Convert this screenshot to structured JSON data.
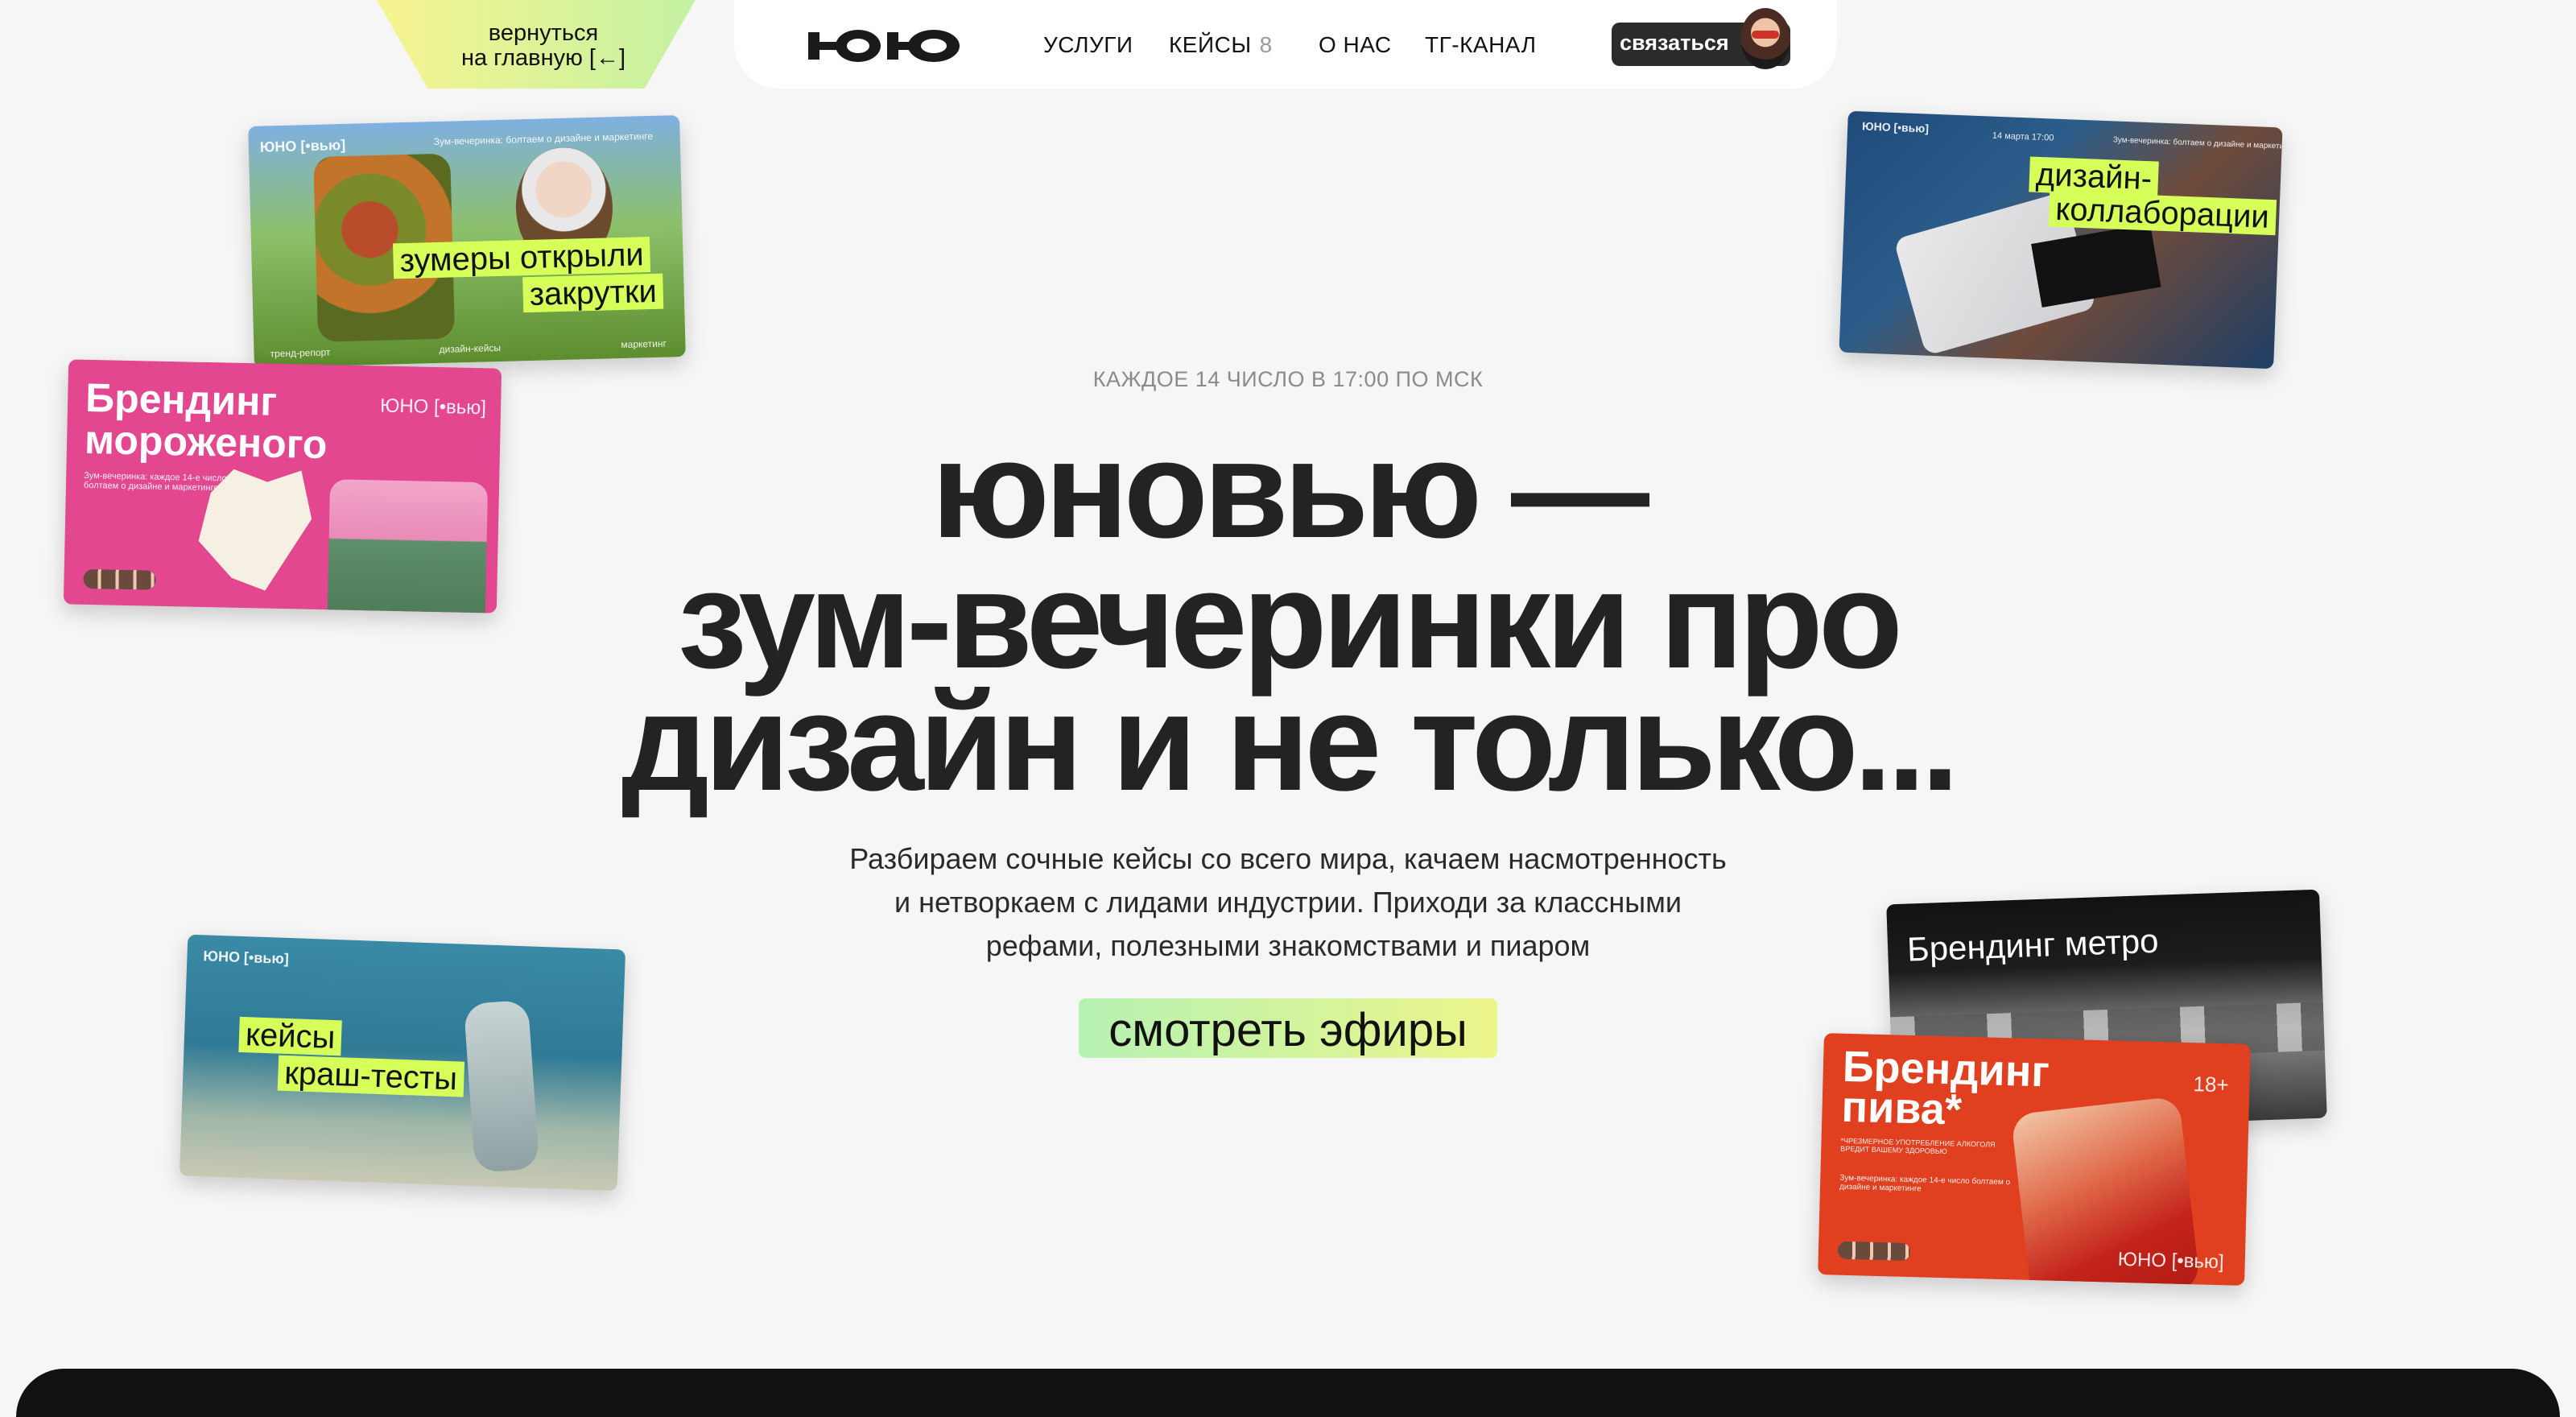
{
  "back_link": {
    "line1": "вернуться",
    "line2": "на главную [←]"
  },
  "nav": {
    "logo_alt": "ЮНО",
    "items": [
      {
        "label": "УСЛУГИ"
      },
      {
        "label": "КЕЙСЫ",
        "count": "8"
      },
      {
        "label": "О НАС"
      },
      {
        "label": "ТГ-КАНАЛ"
      }
    ],
    "contact_label": "связаться"
  },
  "cards": {
    "zoomers": {
      "logo": "ЮНО [•вью]",
      "header": "Зум-вечеринка: болтаем о дизайне и маркетинге",
      "tag_line1": "зумеры открыли",
      "tag_line2": "закрутки",
      "foot1": "тренд-репорт",
      "foot2": "дизайн-кейсы",
      "foot3": "маркетинг"
    },
    "ice_cream": {
      "title_line1": "Брендинг",
      "title_line2": "мороженого",
      "logo": "ЮНО [•вью]",
      "sub": "Зум-вечеринка: каждое 14-е число болтаем о дизайне и маркетинге"
    },
    "collab": {
      "logo": "ЮНО [•вью]",
      "date": "14 марта 17:00",
      "header": "Зум-вечеринка: болтаем о дизайне и маркетинге",
      "tag_line1": "дизайн-",
      "tag_line2": "коллаборации"
    },
    "crash": {
      "logo": "ЮНО [•вью]",
      "tag_line1": "кейсы",
      "tag_line2": "краш-тесты"
    },
    "metro": {
      "title": "Брендинг метро"
    },
    "beer": {
      "title_line1": "Брендинг",
      "title_line2": "пива*",
      "age": "18+",
      "warning": "*ЧРЕЗМЕРНОЕ УПОТРЕБЛЕНИЕ АЛКОГОЛЯ ВРЕДИТ ВАШЕМУ ЗДОРОВЬЮ",
      "sub": "Зум-вечеринка: каждое 14-е число болтаем о дизайне и маркетинге",
      "logo": "ЮНО [•вью]"
    }
  },
  "hero": {
    "eyebrow": "КАЖДОЕ 14 ЧИСЛО В 17:00 ПО МСК",
    "title_line1": "юновью —",
    "title_line2": "зум-вечеринки про",
    "title_line3": "дизайн и не только...",
    "desc_line1": "Разбираем сочные кейсы со всего мира, качаем насмотренность",
    "desc_line2": "и нетворкаем с лидами индустрии. Приходи за классными",
    "desc_line3": "рефами, полезными знакомствами и пиаром",
    "cta": "смотреть эфиры"
  },
  "colors": {
    "accent_lime": "#d7ff5a",
    "dark": "#232323",
    "background": "#f6f6f6",
    "pink": "#e2478f",
    "red": "#e0401f"
  }
}
